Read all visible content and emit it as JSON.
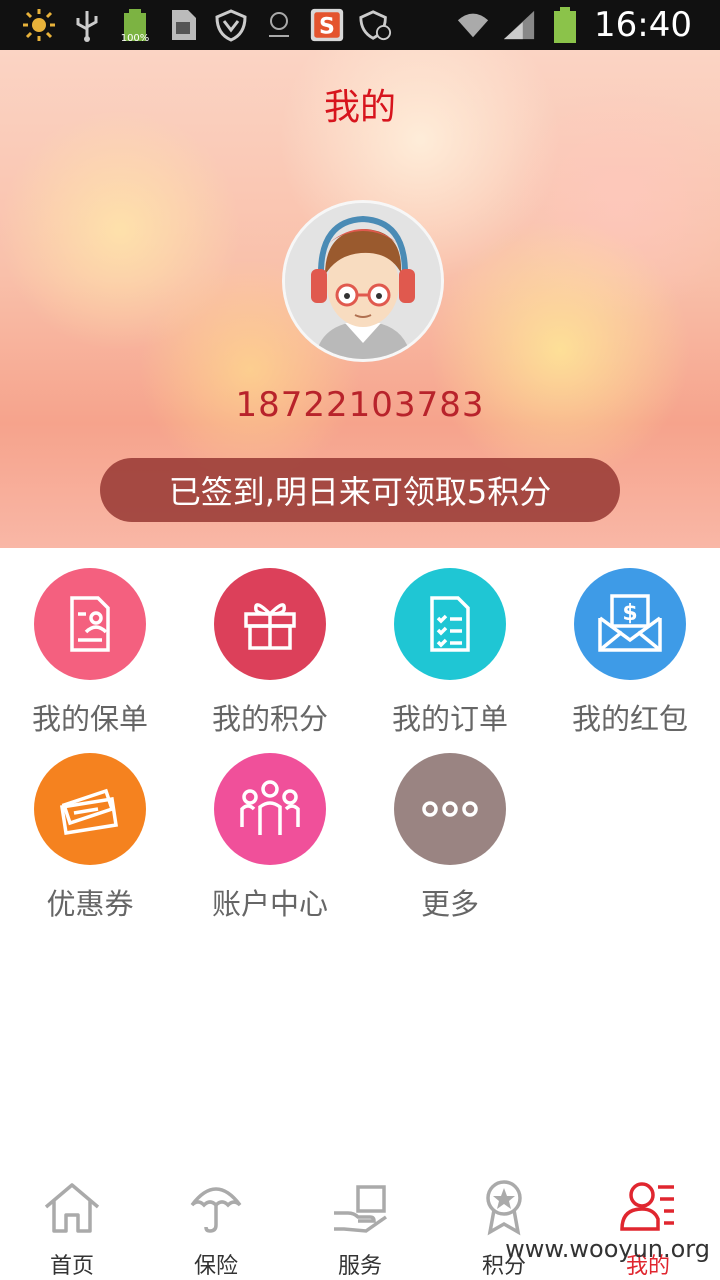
{
  "status_bar": {
    "battery_small_label": "100%",
    "time": "16:40"
  },
  "header": {
    "title": "我的",
    "phone": "18722103783",
    "checkin_text": "已签到,明日来可领取5积分"
  },
  "grid": {
    "items": [
      {
        "label": "我的保单",
        "icon": "policy-icon",
        "color": "#f4607f"
      },
      {
        "label": "我的积分",
        "icon": "gift-icon",
        "color": "#dc405a"
      },
      {
        "label": "我的订单",
        "icon": "order-list-icon",
        "color": "#1fc6d4"
      },
      {
        "label": "我的红包",
        "icon": "red-envelope-icon",
        "color": "#3e9be7"
      },
      {
        "label": "优惠券",
        "icon": "coupon-icon",
        "color": "#f5821f"
      },
      {
        "label": "账户中心",
        "icon": "account-center-icon",
        "color": "#f0509a"
      },
      {
        "label": "更多",
        "icon": "more-icon",
        "color": "#9a8482"
      }
    ]
  },
  "bottom_nav": {
    "items": [
      {
        "label": "首页",
        "icon": "home-icon"
      },
      {
        "label": "保险",
        "icon": "umbrella-icon"
      },
      {
        "label": "服务",
        "icon": "service-icon"
      },
      {
        "label": "积分",
        "icon": "points-medal-icon"
      },
      {
        "label": "我的",
        "icon": "profile-icon",
        "active": true
      }
    ]
  },
  "watermark": "www.wooyun.org",
  "colors": {
    "accent": "#e0262f",
    "title_red": "#d7141d"
  }
}
